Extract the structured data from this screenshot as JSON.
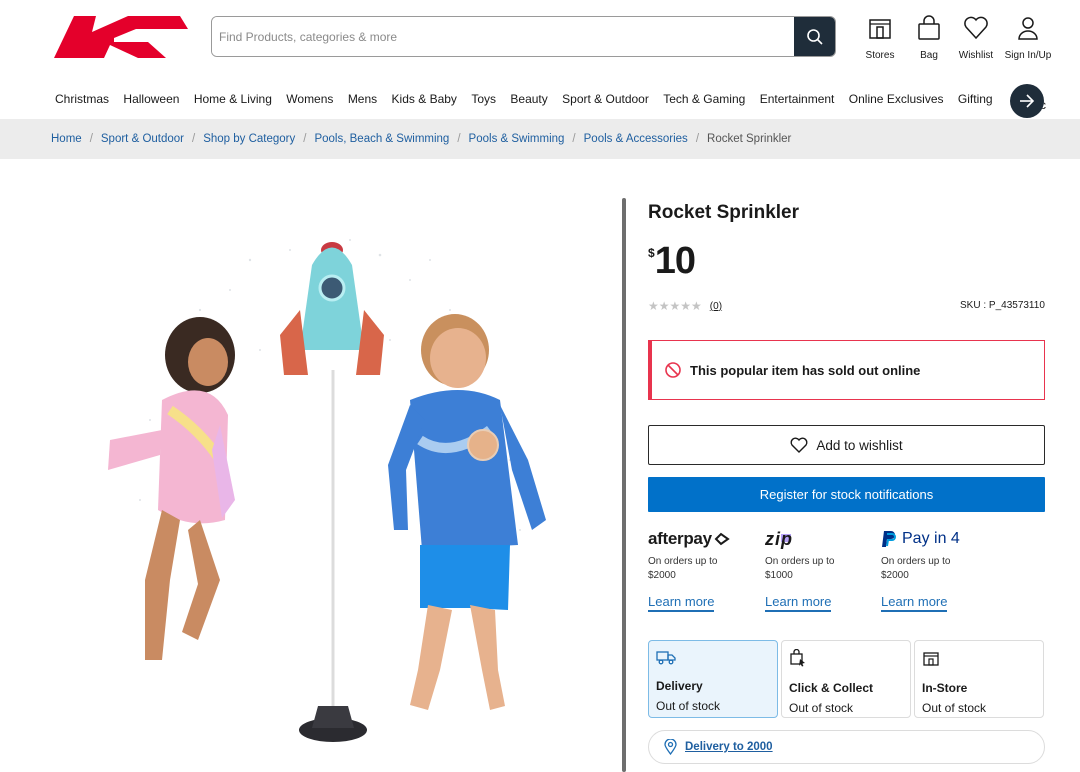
{
  "header": {
    "search_placeholder": "Find Products, categories & more",
    "icons": [
      {
        "label": "Stores",
        "icon": "store-icon"
      },
      {
        "label": "Bag",
        "icon": "bag-icon"
      },
      {
        "label": "Wishlist",
        "icon": "heart-icon"
      },
      {
        "label": "Sign In/Up",
        "icon": "user-icon"
      }
    ],
    "brand_color": "#e4002b"
  },
  "nav": {
    "items": [
      "Christmas",
      "Halloween",
      "Home & Living",
      "Womens",
      "Mens",
      "Kids & Baby",
      "Toys",
      "Beauty",
      "Sport & Outdoor",
      "Tech & Gaming",
      "Entertainment",
      "Online Exclusives",
      "Gifting"
    ],
    "overflow_text": "c"
  },
  "breadcrumb": [
    "Home",
    "Sport & Outdoor",
    "Shop by Category",
    "Pools, Beach & Swimming",
    "Pools & Swimming",
    "Pools & Accessories",
    "Rocket Sprinkler"
  ],
  "product": {
    "title": "Rocket Sprinkler",
    "currency": "$",
    "price": "10",
    "rating_count": "(0)",
    "rating_value": 0,
    "sku": "SKU : P_43573110"
  },
  "alert": {
    "text": "This popular item has sold out online",
    "color": "#e8344e"
  },
  "actions": {
    "wishlist_label": "Add to wishlist",
    "notify_label": "Register for stock notifications",
    "notify_color": "#0171c9"
  },
  "payments": [
    {
      "brand": "afterpay",
      "desc_line1": "On orders up to",
      "desc_line2": "$2000",
      "learn": "Learn more"
    },
    {
      "brand": "zip",
      "desc_line1": "On orders up to",
      "desc_line2": "$1000",
      "learn": "Learn more"
    },
    {
      "brand": "Pay in 4",
      "desc_line1": "On orders up to",
      "desc_line2": "$2000",
      "learn": "Learn more"
    }
  ],
  "fulfilment": [
    {
      "title": "Delivery",
      "status": "Out of stock",
      "icon": "truck-icon"
    },
    {
      "title": "Click & Collect",
      "status": "Out of stock",
      "icon": "click-collect-icon"
    },
    {
      "title": "In-Store",
      "status": "Out of stock",
      "icon": "store-icon"
    }
  ],
  "delivery_link": "Delivery to 2000"
}
